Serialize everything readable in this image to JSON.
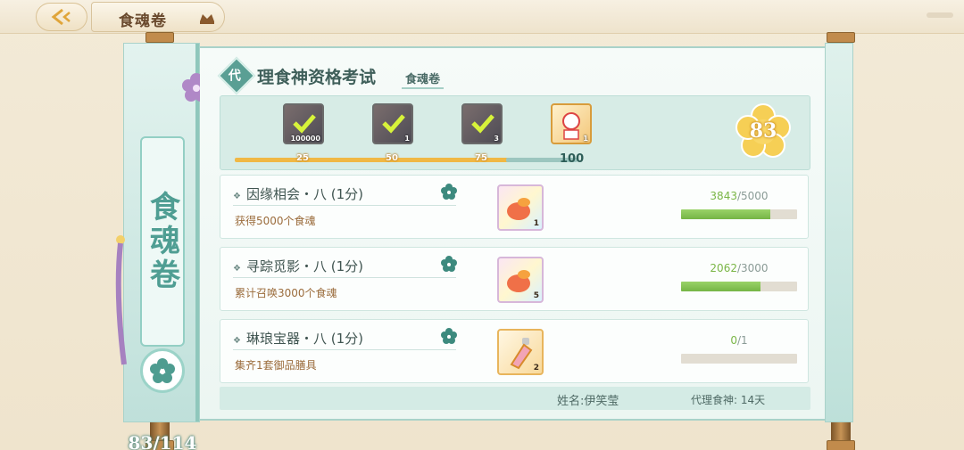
{
  "header": {
    "title": "食魂卷"
  },
  "scroll": {
    "vertical_title": "食魂卷",
    "collection_count": "83/114"
  },
  "exam": {
    "badge": "代",
    "title": "理食神资格考试",
    "subtitle": "食魂卷"
  },
  "rewards": {
    "items": [
      {
        "qty": "100000",
        "claimed": true
      },
      {
        "qty": "1",
        "claimed": true
      },
      {
        "qty": "3",
        "claimed": true
      },
      {
        "qty": "1",
        "claimed": false
      }
    ],
    "milestones": [
      "25",
      "50",
      "75",
      "100"
    ],
    "current_score": "83",
    "progress_fraction": 0.83
  },
  "tasks": [
    {
      "name": "因缘相会・八 (1分)",
      "desc": "获得5000个食魂",
      "reward_qty": "1",
      "current": "3843",
      "total": "/5000",
      "progress": 0.7686
    },
    {
      "name": "寻踪觅影・八 (1分)",
      "desc": "累计召唤3000个食魂",
      "reward_qty": "5",
      "current": "2062",
      "total": "/3000",
      "progress": 0.6873
    },
    {
      "name": "琳琅宝器・八 (1分)",
      "desc": "集齐1套御品膳具",
      "reward_qty": "2",
      "current": "0",
      "total": "/1",
      "progress": 0
    }
  ],
  "footer": {
    "name": "姓名:伊笑莹",
    "duration": "代理食神: 14天"
  },
  "colors": {
    "accent_teal": "#5a9f94",
    "progress_gold": "#f0b845",
    "progress_green": "#75b545",
    "reward_text_brown": "#9b6c3c"
  }
}
